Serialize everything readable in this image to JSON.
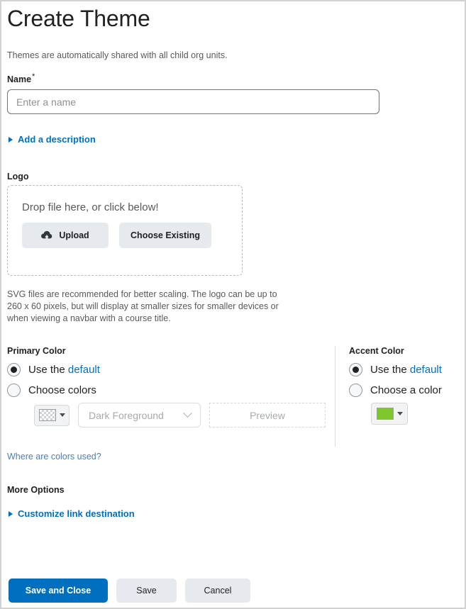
{
  "header": {
    "title": "Create Theme"
  },
  "intro": {
    "text": "Themes are automatically shared with all child org units."
  },
  "name_field": {
    "label": "Name",
    "required_marker": "*",
    "value": "",
    "placeholder": "Enter a name"
  },
  "description_disclosure": {
    "label": "Add a description",
    "icon": "triangle-right-icon",
    "expanded": false
  },
  "logo": {
    "label": "Logo",
    "dropzone_text": "Drop file here, or click below!",
    "upload_button": "Upload",
    "upload_icon": "cloud-upload-icon",
    "choose_existing_button": "Choose Existing",
    "help_text": "SVG files are recommended for better scaling. The logo can be up to 260 x 60 pixels, but will display at smaller sizes for smaller devices or when viewing a navbar with a course title."
  },
  "primary_color": {
    "label": "Primary Color",
    "option_default_prefix": "Use the ",
    "option_default_link": "default",
    "option_default_selected": true,
    "option_choose": "Choose colors",
    "option_choose_selected": false,
    "swatch_color": "transparent",
    "swatch_icon": "checkerboard-swatch-icon",
    "caret_icon": "caret-down-icon",
    "foreground_select_value": "Dark Foreground",
    "foreground_select_icon": "chevron-down-icon",
    "preview_label": "Preview"
  },
  "accent_color": {
    "label": "Accent Color",
    "option_default_prefix": "Use the ",
    "option_default_link": "default",
    "option_default_selected": true,
    "option_choose": "Choose a color",
    "option_choose_selected": false,
    "swatch_color": "#7dc62e",
    "caret_icon": "caret-down-icon"
  },
  "colors_help_link": {
    "label": "Where are colors used?"
  },
  "more_options": {
    "label": "More Options",
    "customize_link": "Customize link destination",
    "icon": "triangle-right-icon"
  },
  "footer": {
    "save_and_close": "Save and Close",
    "save": "Save",
    "cancel": "Cancel"
  },
  "theme": {
    "accent_blue": "#006fbf",
    "link_blue": "#4a7ebb",
    "button_gray": "#e6eaef",
    "text_dark": "#202122",
    "text_muted": "#565a5c"
  }
}
